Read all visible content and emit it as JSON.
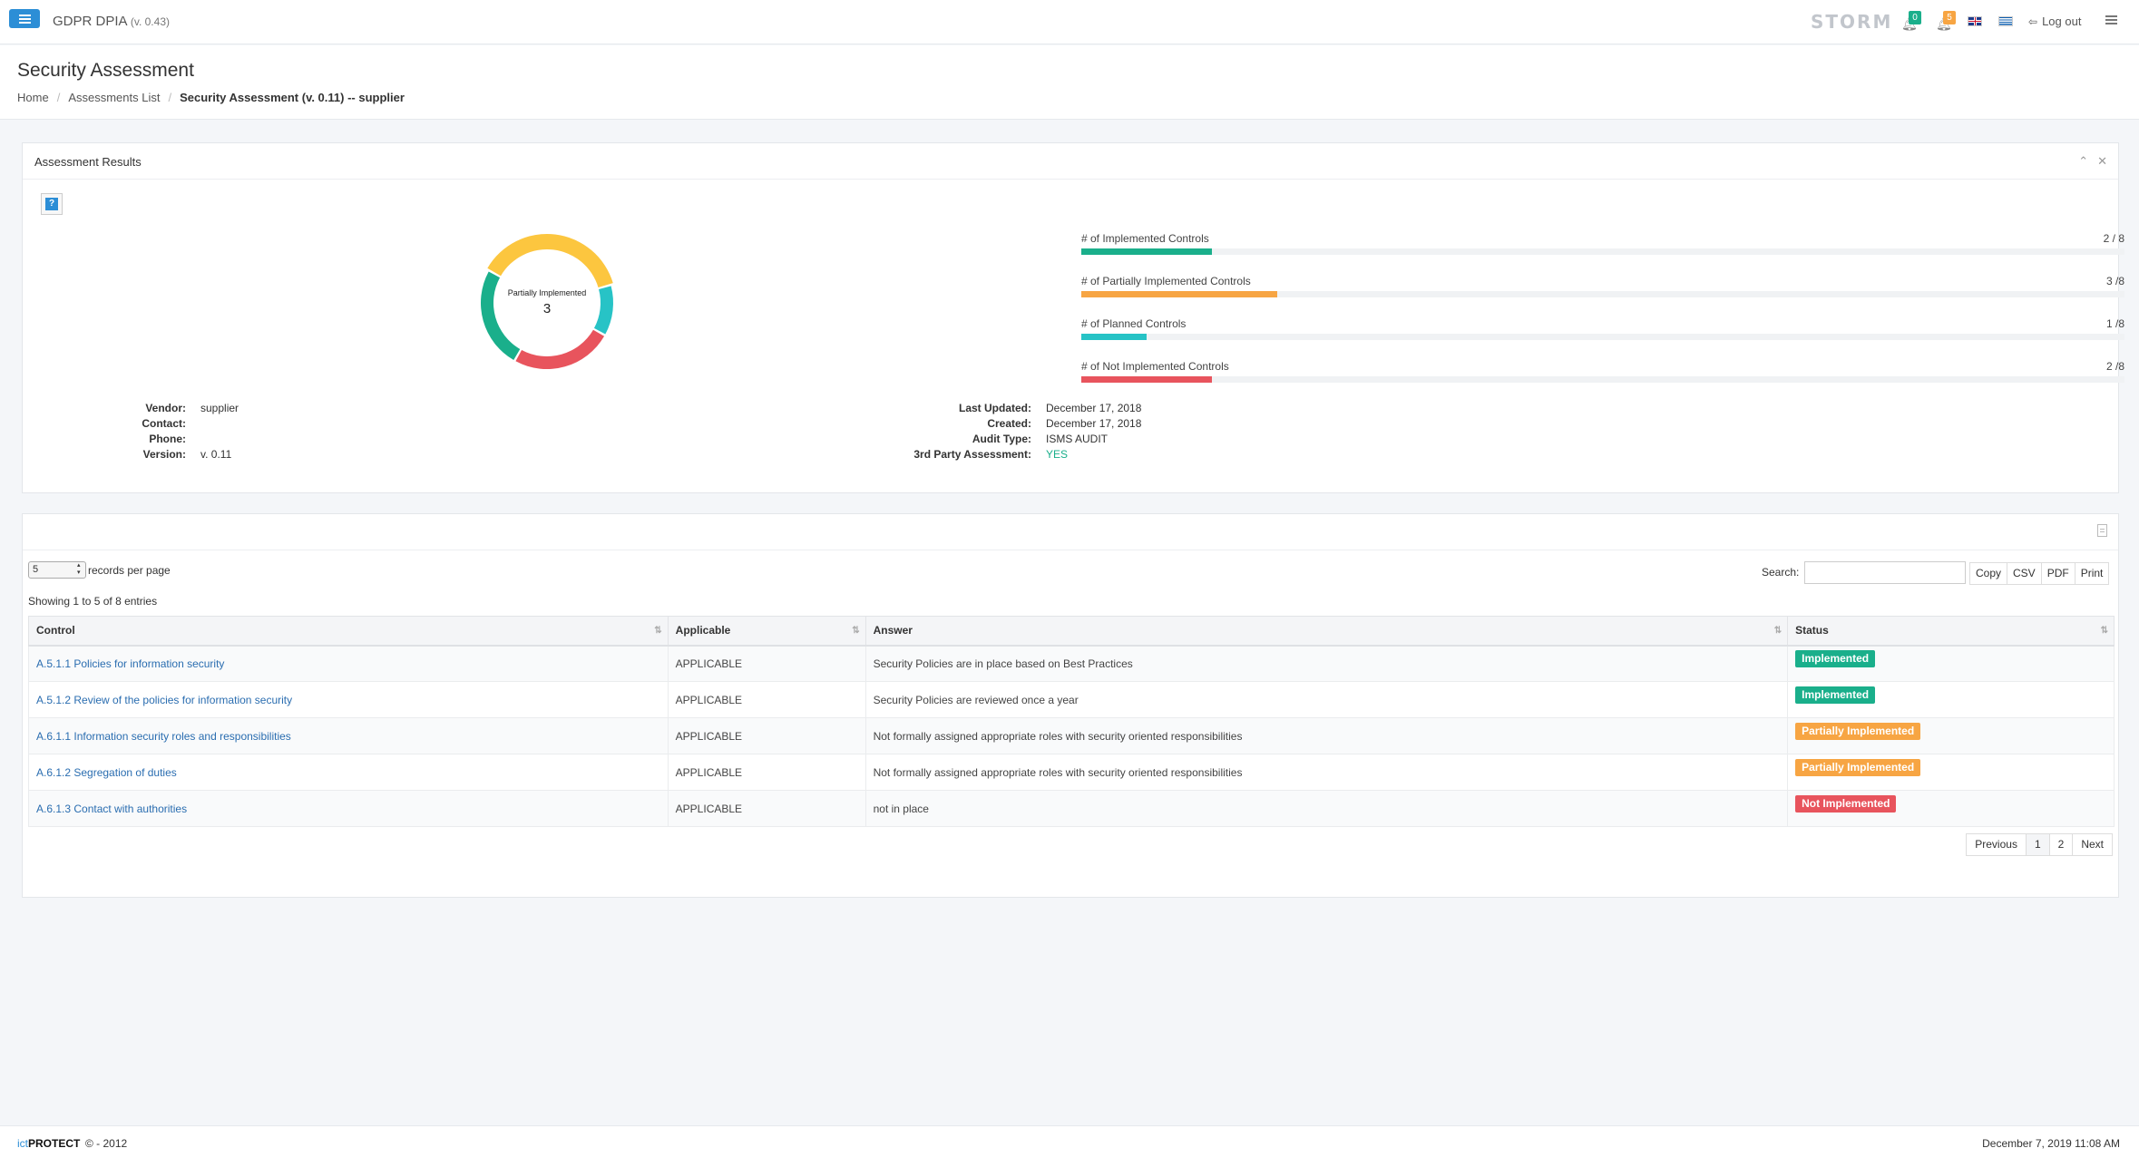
{
  "topbar": {
    "app_name": "GDPR DPIA",
    "app_version": "(v. 0.43)",
    "logo_text": "STORM",
    "notif_green_count": "0",
    "notif_orange_count": "5",
    "logout_label": "Log out",
    "colors": {
      "primary": "#2c8ed6",
      "green": "#1aaf8b",
      "orange": "#f7a543"
    }
  },
  "header": {
    "title": "Security Assessment",
    "breadcrumb": [
      "Home",
      "Assessments List",
      "Security Assessment (v. 0.11) -- supplier"
    ]
  },
  "results": {
    "title": "Assessment Results",
    "donut": {
      "label": "Partially Implemented",
      "value": "3",
      "slices": [
        {
          "name": "Implemented",
          "value": 2,
          "color": "#1aaf8b"
        },
        {
          "name": "Partially Implemented",
          "value": 3,
          "color": "#fcc63f"
        },
        {
          "name": "Planned",
          "value": 1,
          "color": "#27c3c6"
        },
        {
          "name": "Not Implemented",
          "value": 2,
          "color": "#e8545d"
        }
      ]
    },
    "bars": [
      {
        "label": "# of Implemented Controls",
        "count": "2 / 8",
        "value": 2,
        "total": 8,
        "color": "#1aaf8b"
      },
      {
        "label": "# of Partially Implemented Controls",
        "count": "3 /8",
        "value": 3,
        "total": 8,
        "color": "#f7a543"
      },
      {
        "label": "# of Planned Controls",
        "count": "1 /8",
        "value": 1,
        "total": 8,
        "color": "#27c3c6"
      },
      {
        "label": "# of Not Implemented Controls",
        "count": "2 /8",
        "value": 2,
        "total": 8,
        "color": "#e8545d"
      }
    ],
    "info_left": [
      {
        "key": "Vendor:",
        "value": "supplier"
      },
      {
        "key": "Contact:",
        "value": ""
      },
      {
        "key": "Phone:",
        "value": ""
      },
      {
        "key": "Version:",
        "value": "v. 0.11"
      }
    ],
    "info_right": [
      {
        "key": "Last Updated:",
        "value": "December 17, 2018"
      },
      {
        "key": "Created:",
        "value": "December 17, 2018"
      },
      {
        "key": "Audit Type:",
        "value": "ISMS AUDIT"
      },
      {
        "key": "3rd Party Assessment:",
        "value": "YES"
      }
    ]
  },
  "table": {
    "length_value": "5",
    "length_label": "records per page",
    "search_label": "Search:",
    "search_value": "",
    "export_buttons": [
      "Copy",
      "CSV",
      "PDF",
      "Print"
    ],
    "showing": "Showing 1 to 5 of 8 entries",
    "columns": [
      "Control",
      "Applicable",
      "Answer",
      "Status"
    ],
    "rows": [
      {
        "control": "A.5.1.1 Policies for information security",
        "applicable": "APPLICABLE",
        "answer": "Security Policies are in place based on Best Practices",
        "status": "Implemented",
        "status_type": "impl"
      },
      {
        "control": "A.5.1.2 Review of the policies for information security",
        "applicable": "APPLICABLE",
        "answer": "Security Policies are reviewed once a year",
        "status": "Implemented",
        "status_type": "impl"
      },
      {
        "control": "A.6.1.1 Information security roles and responsibilities",
        "applicable": "APPLICABLE",
        "answer": "Not formally assigned appropriate roles with security oriented responsibilities",
        "status": "Partially Implemented",
        "status_type": "part"
      },
      {
        "control": "A.6.1.2 Segregation of duties",
        "applicable": "APPLICABLE",
        "answer": "Not formally assigned appropriate roles with security oriented responsibilities",
        "status": "Partially Implemented",
        "status_type": "part"
      },
      {
        "control": "A.6.1.3 Contact with authorities",
        "applicable": "APPLICABLE",
        "answer": "not in place",
        "status": "Not Implemented",
        "status_type": "not"
      }
    ],
    "pagination": [
      "Previous",
      "1",
      "2",
      "Next"
    ],
    "current_page": "1"
  },
  "footer": {
    "brand_prefix": "ict",
    "brand_name": "PROTECT",
    "copyright": "© - 2012",
    "datetime": "December 7, 2019 11:08 AM"
  }
}
